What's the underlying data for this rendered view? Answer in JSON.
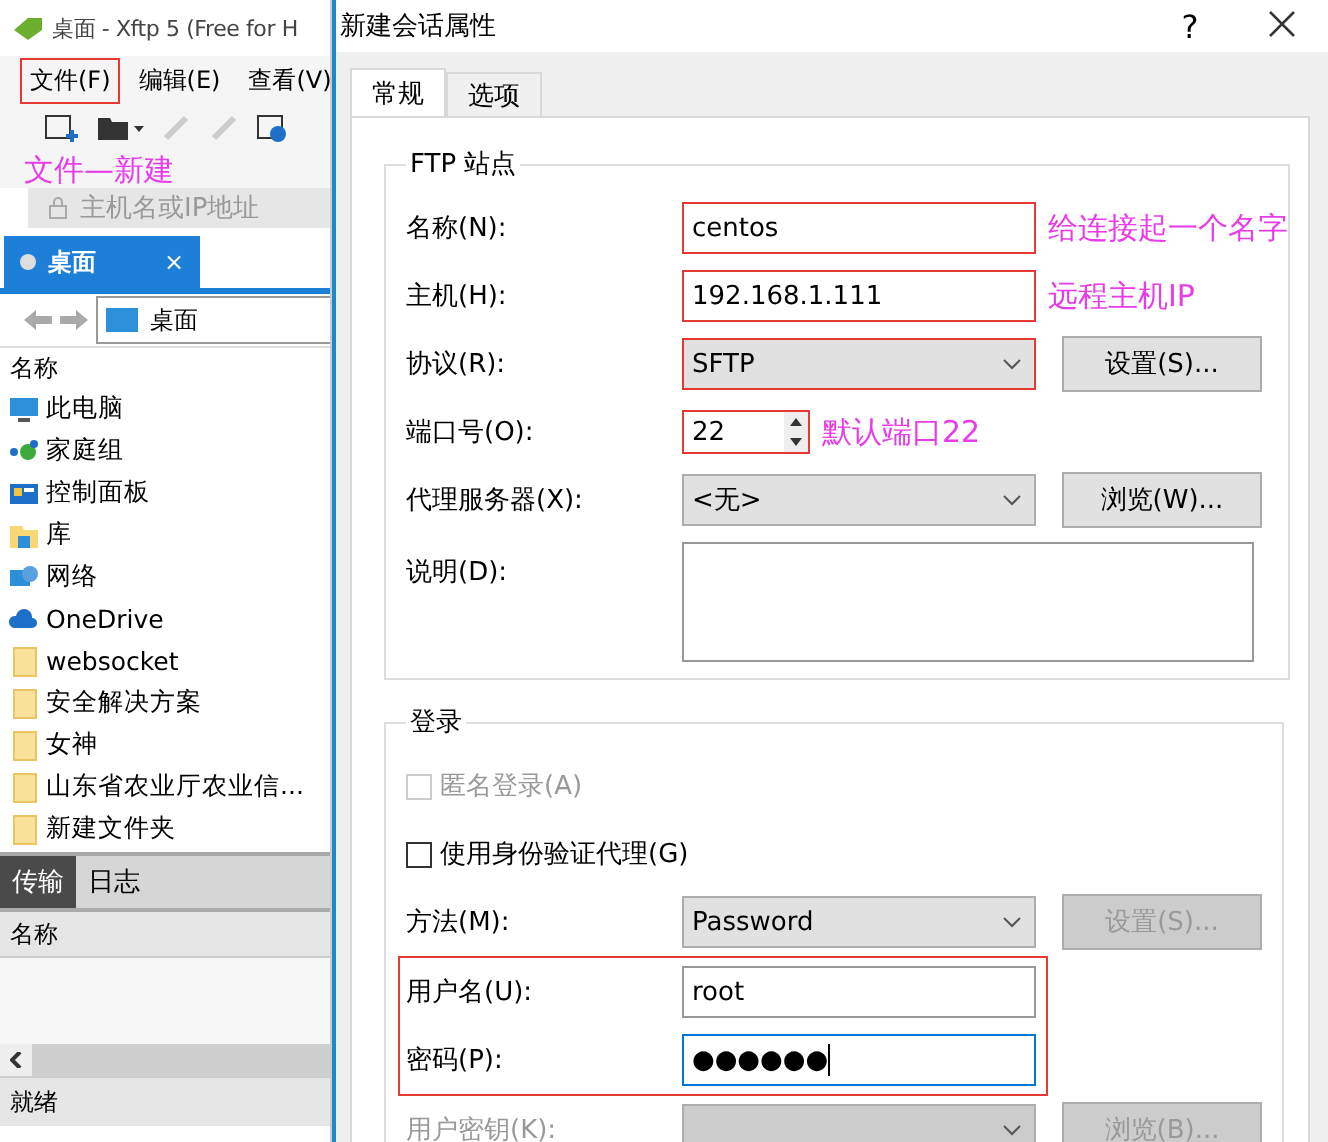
{
  "left_window": {
    "title": "桌面 - Xftp 5 (Free for H",
    "menu": [
      {
        "label": "文件(F)",
        "outlined": true
      },
      {
        "label": "编辑(E)",
        "outlined": false
      },
      {
        "label": "查看(V)",
        "outlined": false
      }
    ],
    "annotation": "文件—新建",
    "address_placeholder": "主机名或IP地址",
    "session_tab": {
      "label": "桌面",
      "close": "×"
    },
    "path": "桌面",
    "list_header": "名称",
    "files": [
      {
        "name": "此电脑",
        "kind": "computer"
      },
      {
        "name": "家庭组",
        "kind": "homegroup"
      },
      {
        "name": "控制面板",
        "kind": "control-panel"
      },
      {
        "name": "库",
        "kind": "library"
      },
      {
        "name": "网络",
        "kind": "network"
      },
      {
        "name": "OneDrive",
        "kind": "cloud"
      },
      {
        "name": "websocket",
        "kind": "folder"
      },
      {
        "name": "安全解决方案",
        "kind": "folder"
      },
      {
        "name": "女神",
        "kind": "folder"
      },
      {
        "name": "山东省农业厅农业信...",
        "kind": "folder"
      },
      {
        "name": "新建文件夹",
        "kind": "folder"
      }
    ],
    "bottom_tabs": [
      {
        "label": "传输",
        "selected": true
      },
      {
        "label": "日志",
        "selected": false
      }
    ],
    "transfer_header": "名称",
    "status": "就绪"
  },
  "dialog": {
    "title": "新建会话属性",
    "help": "?",
    "tabs": [
      {
        "label": "常规",
        "selected": true
      },
      {
        "label": "选项",
        "selected": false
      }
    ],
    "groups": [
      {
        "title": "FTP 站点",
        "rows": [
          {
            "kind": "text",
            "label": "名称(N):",
            "value": "centos",
            "input_outlined": true,
            "note": "给连接起一个名字"
          },
          {
            "kind": "text",
            "label": "主机(H):",
            "value": "192.168.1.111",
            "input_outlined": true,
            "note": "远程主机IP"
          },
          {
            "kind": "select",
            "label": "协议(R):",
            "value": "SFTP",
            "input_outlined": true,
            "button": "设置(S)...",
            "button_disabled": false
          },
          {
            "kind": "spin",
            "label": "端口号(O):",
            "value": "22",
            "input_outlined": true,
            "note": "默认端口22"
          },
          {
            "kind": "select",
            "label": "代理服务器(X):",
            "value": "<无>",
            "input_outlined": false,
            "button": "浏览(W)...",
            "button_disabled": false
          },
          {
            "kind": "textarea",
            "label": "说明(D):"
          }
        ]
      },
      {
        "title": "登录",
        "rows": [
          {
            "kind": "checkbox",
            "label": "匿名登录(A)",
            "checked": false,
            "disabled": true
          },
          {
            "kind": "checkbox",
            "label": "使用身份验证代理(G)",
            "checked": false,
            "disabled": false
          },
          {
            "kind": "select",
            "label": "方法(M):",
            "value": "Password",
            "input_outlined": false,
            "button": "设置(S)...",
            "button_disabled": true
          },
          {
            "kind": "text",
            "label": "用户名(U):",
            "value": "root",
            "row_outlined": true
          },
          {
            "kind": "password",
            "label": "密码(P):",
            "value": "●●●●●●",
            "row_outlined": true,
            "focused": true
          },
          {
            "kind": "select",
            "label": "用户密钥(K):",
            "disabled": true,
            "button": "浏览(B)...",
            "button_disabled": true
          }
        ]
      }
    ]
  }
}
